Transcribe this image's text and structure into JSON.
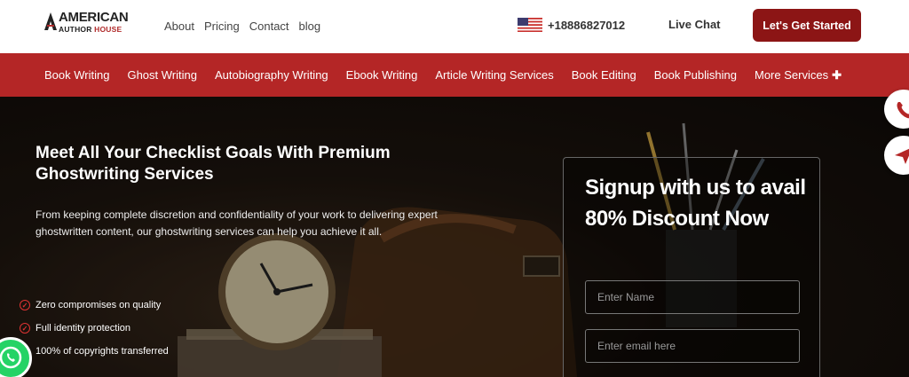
{
  "header": {
    "logo_line1": "AMERICAN",
    "logo_line2a": "AUTHOR ",
    "logo_line2b": "HOUSE",
    "nav": [
      "About",
      "Pricing",
      "Contact",
      "blog"
    ],
    "phone": "+18886827012",
    "live_chat": "Live Chat",
    "cta_label": "Let's Get Started"
  },
  "services_nav": [
    "Book Writing",
    "Ghost Writing",
    "Autobiography Writing",
    "Ebook Writing",
    "Article Writing Services",
    "Book Editing",
    "Book Publishing",
    "More Services"
  ],
  "hero": {
    "title": "Meet All Your Checklist Goals With Premium Ghostwriting Services",
    "description": "From keeping complete discretion and confidentiality of your work to delivering expert ghostwritten content, our ghostwriting services can help you achieve it all.",
    "checks": [
      "Zero compromises on quality",
      "Full identity protection",
      "100% of copyrights transferred"
    ]
  },
  "signup": {
    "title": "Signup with us to avail 80% Discount Now",
    "name_placeholder": "Enter Name",
    "email_placeholder": "Enter email here"
  },
  "colors": {
    "brand_red": "#b42626",
    "cta_dark_red": "#8c1515",
    "whatsapp_green": "#25d366"
  },
  "icons": [
    "us-flag-icon",
    "plus-icon",
    "check-circle-icon",
    "phone-icon",
    "send-icon",
    "whatsapp-icon"
  ]
}
